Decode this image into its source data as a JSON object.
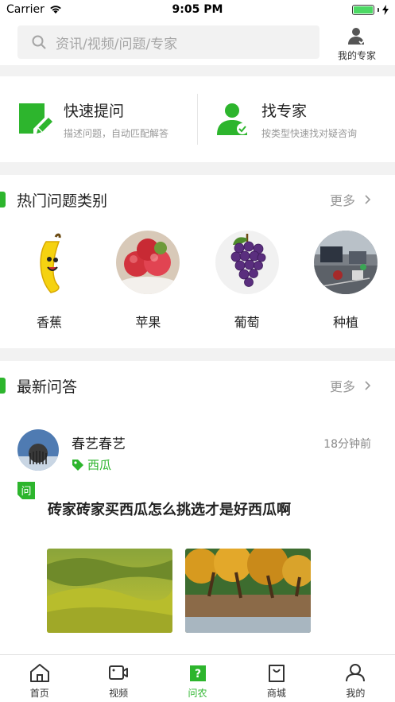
{
  "status_bar": {
    "carrier": "Carrier",
    "time": "9:05 PM"
  },
  "search": {
    "placeholder": "资讯/视频/问题/专家"
  },
  "my_expert": {
    "label": "我的专家"
  },
  "quick_actions": [
    {
      "title": "快速提问",
      "subtitle": "描述问题，自动匹配解答",
      "icon": "edit-square-icon"
    },
    {
      "title": "找专家",
      "subtitle": "按类型快速找对疑咨询",
      "icon": "expert-user-icon"
    }
  ],
  "hot_categories": {
    "title": "热门问题类别",
    "more": "更多",
    "items": [
      {
        "label": "香蕉",
        "icon": "banana-icon"
      },
      {
        "label": "苹果",
        "icon": "apple-icon"
      },
      {
        "label": "葡萄",
        "icon": "grape-icon"
      },
      {
        "label": "种植",
        "icon": "planting-icon"
      }
    ]
  },
  "latest_qa": {
    "title": "最新问答",
    "more": "更多",
    "post": {
      "username": "春艺春艺",
      "tag": "西瓜",
      "time_ago": "18分钟前",
      "badge": "问",
      "question": "砖家砖家买西瓜怎么挑选才是好西瓜啊"
    }
  },
  "tabbar": [
    {
      "label": "首页",
      "icon": "home-icon"
    },
    {
      "label": "视频",
      "icon": "video-icon"
    },
    {
      "label": "问农",
      "icon": "question-icon",
      "active": true
    },
    {
      "label": "商城",
      "icon": "shop-bag-icon"
    },
    {
      "label": "我的",
      "icon": "user-icon"
    }
  ],
  "colors": {
    "accent": "#2db52d",
    "background": "#f2f2f2"
  }
}
